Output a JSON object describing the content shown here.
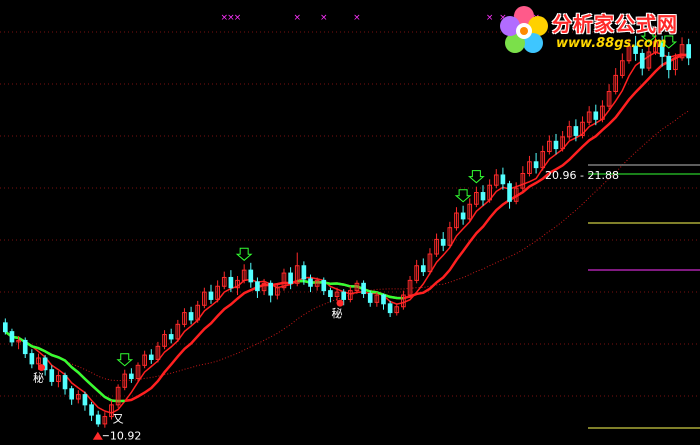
{
  "logo": {
    "title": "分析家公式网",
    "url": "www.88gs.com",
    "icon": "flower-logo-icon"
  },
  "colors": {
    "background": "#000000",
    "grid": "#7a1010",
    "up_candle": "#ff2a2a",
    "down_candle": "#54ffff",
    "ma_fast": "#ff2020",
    "ma_green": "#33ff33",
    "ma_long": "#c81818",
    "ma_dotted": "#33ff33",
    "signal_x": "#ff33ff",
    "arrow": "#33ff33"
  },
  "chart_data": {
    "type": "candlestick",
    "title": "",
    "xlabel": "",
    "ylabel": "",
    "ylim": [
      10.5,
      24.5
    ],
    "grid": true,
    "price_labels": [
      {
        "text": "10.92",
        "index": 15,
        "price": 10.92
      },
      {
        "text": "20.96 - 21.88",
        "index": 94,
        "price": 21.9
      }
    ],
    "annotations": [
      {
        "text": "秘",
        "index": 5,
        "price": 12.7
      },
      {
        "text": "秘",
        "index": 50,
        "price": 14.9
      },
      {
        "text": "又",
        "index": 17,
        "price": 11.3
      }
    ],
    "x_markers": [
      33,
      34,
      35,
      44,
      48,
      53,
      73,
      75,
      77,
      78,
      80
    ],
    "green_arrows": [
      18,
      36,
      69,
      71,
      97,
      100
    ],
    "candles": [
      [
        14.5,
        14.2,
        14.65,
        14.1
      ],
      [
        14.2,
        13.85,
        14.3,
        13.7
      ],
      [
        13.85,
        13.9,
        14.05,
        13.6
      ],
      [
        13.9,
        13.45,
        14.0,
        13.3
      ],
      [
        13.45,
        13.1,
        13.6,
        12.95
      ],
      [
        13.1,
        13.3,
        13.45,
        12.9
      ],
      [
        13.3,
        12.9,
        13.4,
        12.7
      ],
      [
        12.9,
        12.5,
        13.05,
        12.35
      ],
      [
        12.5,
        12.7,
        12.85,
        12.3
      ],
      [
        12.7,
        12.25,
        12.8,
        12.05
      ],
      [
        12.25,
        11.9,
        12.35,
        11.7
      ],
      [
        11.9,
        12.05,
        12.2,
        11.75
      ],
      [
        12.05,
        11.7,
        12.15,
        11.5
      ],
      [
        11.7,
        11.35,
        11.8,
        11.15
      ],
      [
        11.35,
        11.05,
        11.5,
        10.95
      ],
      [
        11.05,
        11.3,
        11.45,
        10.92
      ],
      [
        11.3,
        11.7,
        11.85,
        11.2
      ],
      [
        11.7,
        12.3,
        12.4,
        11.6
      ],
      [
        12.3,
        12.75,
        12.9,
        12.2
      ],
      [
        12.75,
        12.6,
        12.95,
        12.45
      ],
      [
        12.6,
        13.05,
        13.15,
        12.5
      ],
      [
        13.05,
        13.4,
        13.55,
        12.95
      ],
      [
        13.4,
        13.25,
        13.6,
        13.1
      ],
      [
        13.25,
        13.7,
        13.85,
        13.15
      ],
      [
        13.7,
        14.1,
        14.25,
        13.6
      ],
      [
        14.1,
        13.95,
        14.3,
        13.8
      ],
      [
        13.95,
        14.45,
        14.6,
        13.85
      ],
      [
        14.45,
        14.85,
        15.0,
        14.35
      ],
      [
        14.85,
        14.6,
        15.05,
        14.45
      ],
      [
        14.6,
        15.1,
        15.25,
        14.5
      ],
      [
        15.1,
        15.55,
        15.7,
        15.0
      ],
      [
        15.55,
        15.3,
        15.8,
        15.15
      ],
      [
        15.3,
        15.75,
        15.95,
        15.2
      ],
      [
        15.75,
        16.05,
        16.25,
        15.65
      ],
      [
        16.05,
        15.7,
        16.3,
        15.55
      ],
      [
        15.7,
        15.95,
        16.1,
        15.45
      ],
      [
        15.95,
        16.3,
        16.5,
        15.85
      ],
      [
        16.3,
        15.9,
        16.55,
        15.7
      ],
      [
        15.9,
        15.6,
        16.05,
        15.35
      ],
      [
        15.6,
        15.85,
        16.0,
        15.45
      ],
      [
        15.85,
        15.45,
        15.95,
        15.2
      ],
      [
        15.45,
        15.7,
        15.85,
        15.3
      ],
      [
        15.7,
        16.2,
        16.35,
        15.6
      ],
      [
        16.2,
        15.85,
        16.4,
        15.65
      ],
      [
        15.85,
        16.45,
        16.9,
        15.75
      ],
      [
        16.45,
        16.0,
        16.6,
        15.8
      ],
      [
        16.0,
        15.75,
        16.15,
        15.55
      ],
      [
        15.75,
        15.95,
        16.05,
        15.6
      ],
      [
        15.95,
        15.6,
        16.05,
        15.45
      ],
      [
        15.6,
        15.4,
        15.7,
        15.2
      ],
      [
        15.4,
        15.55,
        15.7,
        15.25
      ],
      [
        15.55,
        15.3,
        15.65,
        15.1
      ],
      [
        15.3,
        15.6,
        15.75,
        15.2
      ],
      [
        15.6,
        15.85,
        15.95,
        15.5
      ],
      [
        15.85,
        15.5,
        15.95,
        15.35
      ],
      [
        15.5,
        15.2,
        15.6,
        15.05
      ],
      [
        15.2,
        15.45,
        15.55,
        15.05
      ],
      [
        15.45,
        15.15,
        15.5,
        14.95
      ],
      [
        15.15,
        14.85,
        15.25,
        14.7
      ],
      [
        14.85,
        15.05,
        15.15,
        14.75
      ],
      [
        15.05,
        15.45,
        15.6,
        14.95
      ],
      [
        15.45,
        15.95,
        16.1,
        15.35
      ],
      [
        15.95,
        16.45,
        16.65,
        15.85
      ],
      [
        16.45,
        16.25,
        16.7,
        16.1
      ],
      [
        16.25,
        16.85,
        17.05,
        16.15
      ],
      [
        16.85,
        17.35,
        17.55,
        16.75
      ],
      [
        17.35,
        17.15,
        17.6,
        16.95
      ],
      [
        17.15,
        17.75,
        17.95,
        17.05
      ],
      [
        17.75,
        18.25,
        18.45,
        17.65
      ],
      [
        18.25,
        18.05,
        18.5,
        17.85
      ],
      [
        18.05,
        18.55,
        18.75,
        17.95
      ],
      [
        18.55,
        18.95,
        19.15,
        18.45
      ],
      [
        18.95,
        18.7,
        19.2,
        18.5
      ],
      [
        18.7,
        19.2,
        19.4,
        18.6
      ],
      [
        19.2,
        19.55,
        19.75,
        19.1
      ],
      [
        19.55,
        19.25,
        19.8,
        19.05
      ],
      [
        19.25,
        18.65,
        19.35,
        18.4
      ],
      [
        18.65,
        19.1,
        19.3,
        18.55
      ],
      [
        19.1,
        19.6,
        19.85,
        19.0
      ],
      [
        19.6,
        20.0,
        20.2,
        19.5
      ],
      [
        20.0,
        19.8,
        20.3,
        19.6
      ],
      [
        19.8,
        20.35,
        20.55,
        19.7
      ],
      [
        20.35,
        20.7,
        20.9,
        20.25
      ],
      [
        20.7,
        20.45,
        20.95,
        20.25
      ],
      [
        20.45,
        20.85,
        21.05,
        20.35
      ],
      [
        20.85,
        21.2,
        21.4,
        20.75
      ],
      [
        21.2,
        20.9,
        21.45,
        20.7
      ],
      [
        20.9,
        21.35,
        21.55,
        20.8
      ],
      [
        21.35,
        21.7,
        21.9,
        21.25
      ],
      [
        21.7,
        21.45,
        21.95,
        21.25
      ],
      [
        21.45,
        21.9,
        22.1,
        21.35
      ],
      [
        21.9,
        22.4,
        22.65,
        21.8
      ],
      [
        22.4,
        22.95,
        23.2,
        22.3
      ],
      [
        22.95,
        23.45,
        23.7,
        22.85
      ],
      [
        23.45,
        23.95,
        24.2,
        23.35
      ],
      [
        23.95,
        23.7,
        24.3,
        23.45
      ],
      [
        23.7,
        23.2,
        23.85,
        22.95
      ],
      [
        23.2,
        23.75,
        23.95,
        23.1
      ],
      [
        23.75,
        24.1,
        24.4,
        23.65
      ],
      [
        24.1,
        23.6,
        24.3,
        23.25
      ],
      [
        23.6,
        23.15,
        23.75,
        22.85
      ],
      [
        23.15,
        23.55,
        23.7,
        22.95
      ],
      [
        23.55,
        24.0,
        24.25,
        23.45
      ],
      [
        24.0,
        23.55,
        24.2,
        23.3
      ]
    ]
  }
}
